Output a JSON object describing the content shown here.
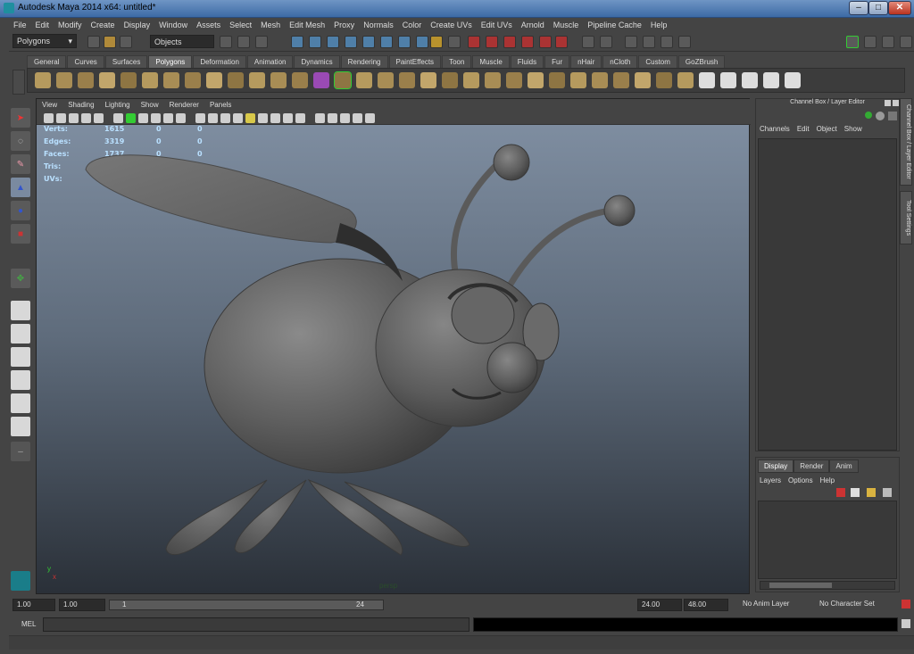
{
  "window": {
    "title": "Autodesk Maya 2014 x64: untitled*"
  },
  "menubar": [
    "File",
    "Edit",
    "Modify",
    "Create",
    "Display",
    "Window",
    "Assets",
    "Select",
    "Mesh",
    "Edit Mesh",
    "Proxy",
    "Normals",
    "Color",
    "Create UVs",
    "Edit UVs",
    "Arnold",
    "Muscle",
    "Pipeline Cache",
    "Help"
  ],
  "statusline": {
    "menuset": "Polygons",
    "selection_mode": "Objects"
  },
  "shelf": {
    "tabs": [
      "General",
      "Curves",
      "Surfaces",
      "Polygons",
      "Deformation",
      "Animation",
      "Dynamics",
      "Rendering",
      "PaintEffects",
      "Toon",
      "Muscle",
      "Fluids",
      "Fur",
      "nHair",
      "nCloth",
      "Custom",
      "GoZBrush"
    ],
    "active_tab": "Polygons"
  },
  "viewport": {
    "menu": [
      "View",
      "Shading",
      "Lighting",
      "Show",
      "Renderer",
      "Panels"
    ],
    "hud": [
      {
        "label": "Verts:",
        "v1": "1615",
        "v2": "0",
        "v3": "0"
      },
      {
        "label": "Edges:",
        "v1": "3319",
        "v2": "0",
        "v3": "0"
      },
      {
        "label": "Faces:",
        "v1": "1737",
        "v2": "0",
        "v3": "0"
      },
      {
        "label": "Tris:",
        "v1": "3161",
        "v2": "0",
        "v3": "0"
      },
      {
        "label": "UVs:",
        "v1": "2083",
        "v2": "0",
        "v3": "0"
      }
    ],
    "camera_label": "persp",
    "axis_y": "y",
    "axis_x": "x"
  },
  "channelbox": {
    "title": "Channel Box / Layer Editor",
    "menu": [
      "Channels",
      "Edit",
      "Object",
      "Show"
    ],
    "side_tabs": [
      "Channel Box / Layer Editor",
      "Tool Settings"
    ]
  },
  "layereditor": {
    "tabs": [
      "Display",
      "Render",
      "Anim"
    ],
    "active_tab": "Display",
    "menu": [
      "Layers",
      "Options",
      "Help"
    ]
  },
  "timeline": {
    "start_time": "1.00",
    "playback_start": "1.00",
    "range_start_label": "1",
    "range_end_label": "24",
    "playback_end": "24.00",
    "end_time": "48.00",
    "anim_layer": "No Anim Layer",
    "character_set": "No Character Set"
  },
  "commandline": {
    "label": "MEL"
  }
}
